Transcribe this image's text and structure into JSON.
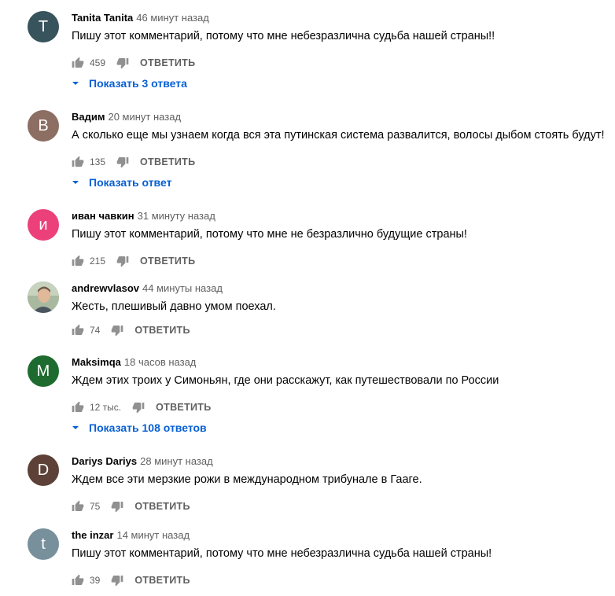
{
  "comments": [
    {
      "author": "Tanita Tanita",
      "time": "46 минут назад",
      "text": "Пишу этот комментарий, потому что мне небезразлична судьба нашей страны!!",
      "likes": "459",
      "reply_label": "ОТВЕТИТЬ",
      "replies": "Показать 3 ответа",
      "avatar_letter": "T",
      "avatar_color": "#37535c"
    },
    {
      "author": "Вадим",
      "time": "20 минут назад",
      "text": "А сколько еще мы узнаем когда вся эта путинская система развалится, волосы дыбом стоять будут!",
      "likes": "135",
      "reply_label": "ОТВЕТИТЬ",
      "replies": "Показать ответ",
      "avatar_letter": "В",
      "avatar_color": "#8d6e63"
    },
    {
      "author": "иван чавкин",
      "time": "31 минуту назад",
      "text": "Пишу этот комментарий, потому что мне не безразлично  будущие страны!",
      "likes": "215",
      "reply_label": "ОТВЕТИТЬ",
      "replies": "",
      "avatar_letter": "и",
      "avatar_color": "#ec407a"
    },
    {
      "author": "andrewvlasov",
      "time": "44 минуты назад",
      "text": "Жесть, плешивый давно умом поехал.",
      "likes": "74",
      "reply_label": "ОТВЕТИТЬ",
      "replies": "",
      "avatar_letter": "",
      "avatar_color": "#b0bec5"
    },
    {
      "author": "Maksimqa",
      "time": "18 часов назад",
      "text": "Ждем этих троих у Симоньян, где они расскажут, как путешествовали по России",
      "likes": "12 тыс.",
      "reply_label": "ОТВЕТИТЬ",
      "replies": "Показать 108 ответов",
      "avatar_letter": "M",
      "avatar_color": "#1e6b2f"
    },
    {
      "author": "Dariys Dariys",
      "time": "28 минут назад",
      "text": "Ждем все эти мерзкие рожи в международном трибунале в Гааге.",
      "likes": "75",
      "reply_label": "ОТВЕТИТЬ",
      "replies": "",
      "avatar_letter": "D",
      "avatar_color": "#5d4037"
    },
    {
      "author": "the inzar",
      "time": "14 минут назад",
      "text": "Пишу этот комментарий, потому что мне небезразлична судьба нашей страны!",
      "likes": "39",
      "reply_label": "ОТВЕТИТЬ",
      "replies": "",
      "avatar_letter": "t",
      "avatar_color": "#78909c"
    }
  ]
}
